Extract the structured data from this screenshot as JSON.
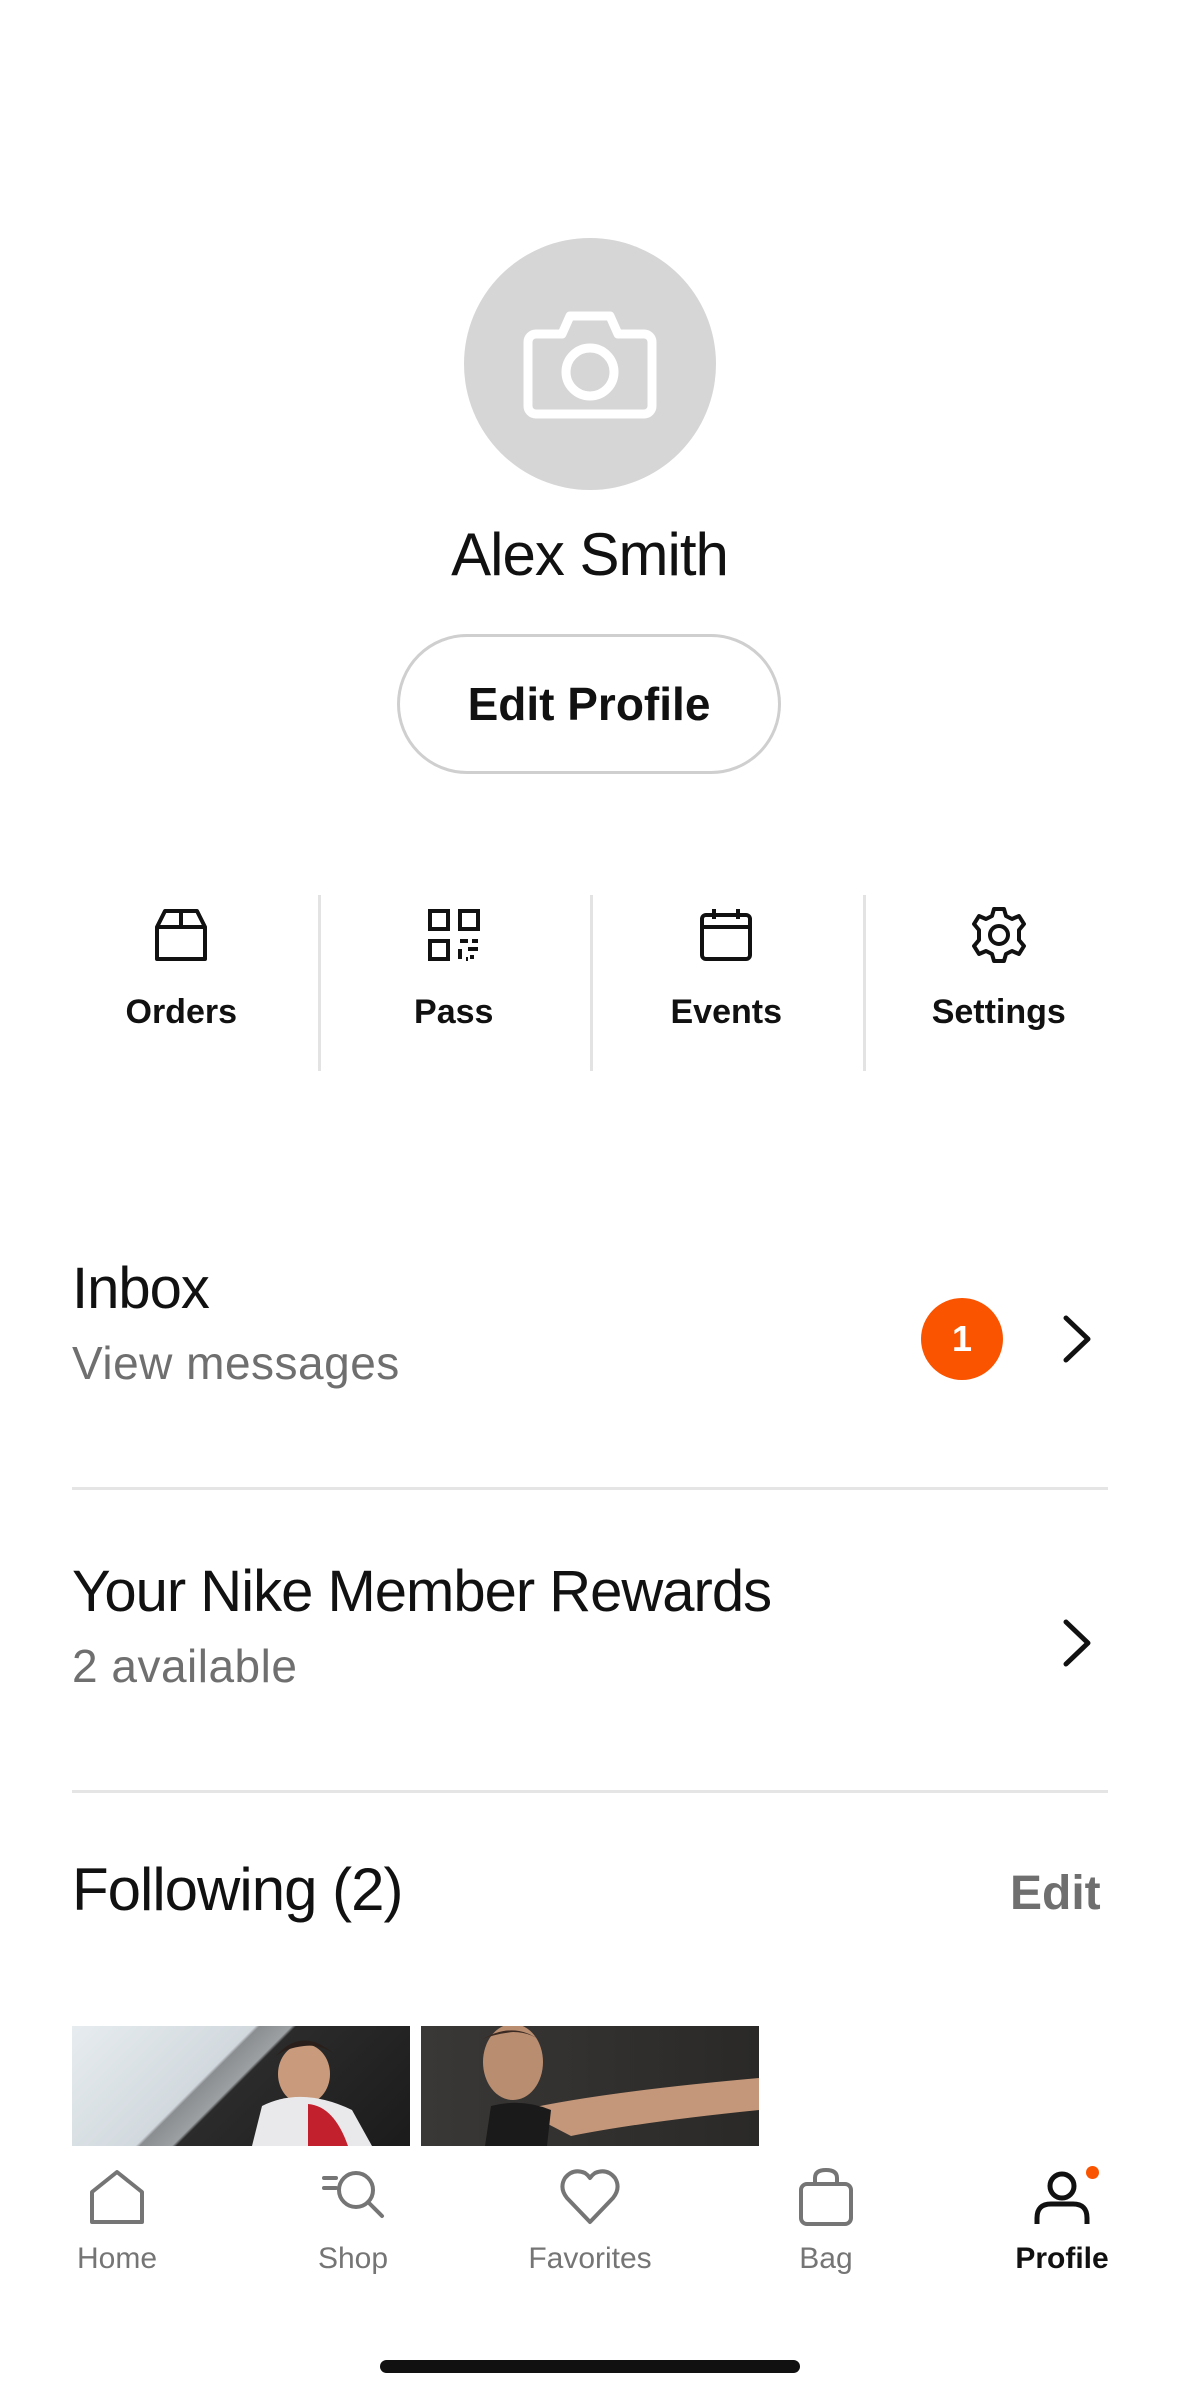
{
  "profile": {
    "name": "Alex Smith",
    "edit_label": "Edit Profile"
  },
  "quick_actions": [
    {
      "label": "Orders",
      "icon": "box-icon"
    },
    {
      "label": "Pass",
      "icon": "qr-code-icon"
    },
    {
      "label": "Events",
      "icon": "calendar-icon"
    },
    {
      "label": "Settings",
      "icon": "gear-icon"
    }
  ],
  "inbox": {
    "title": "Inbox",
    "subtitle": "View messages",
    "badge": "1"
  },
  "rewards": {
    "title": "Your Nike Member Rewards",
    "subtitle": "2 available"
  },
  "following": {
    "title": "Following (2)",
    "edit_label": "Edit"
  },
  "tabs": [
    {
      "label": "Home",
      "icon": "home-icon"
    },
    {
      "label": "Shop",
      "icon": "search-icon"
    },
    {
      "label": "Favorites",
      "icon": "heart-icon"
    },
    {
      "label": "Bag",
      "icon": "bag-icon"
    },
    {
      "label": "Profile",
      "icon": "profile-icon",
      "active": true
    }
  ],
  "colors": {
    "accent": "#fa5400",
    "text": "#111111",
    "muted": "#6f6f6f",
    "avatar_bg": "#d6d6d6"
  }
}
